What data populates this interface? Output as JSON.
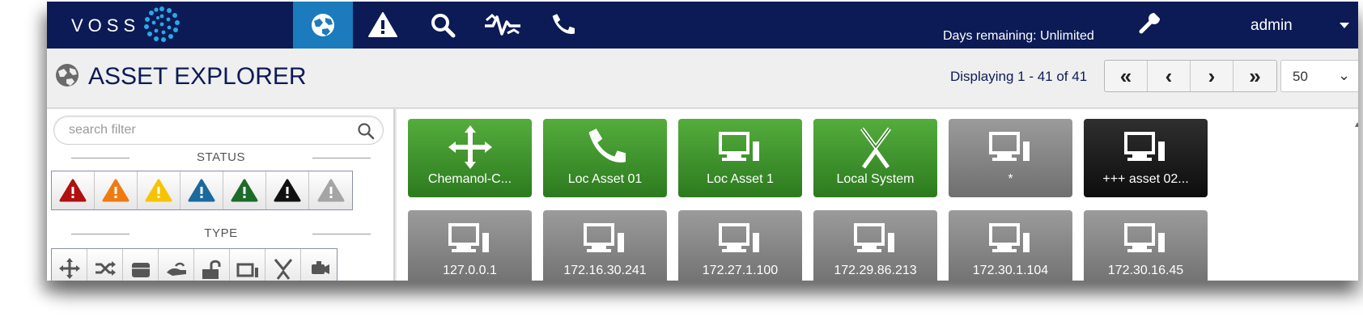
{
  "brand": {
    "logo_text": "VOSS"
  },
  "topnav": {
    "items": [
      {
        "icon": "globe-icon",
        "active": true
      },
      {
        "icon": "alert-icon",
        "active": false
      },
      {
        "icon": "search-icon",
        "active": false
      },
      {
        "icon": "signal-icon",
        "active": false
      },
      {
        "icon": "phone-icon",
        "active": false
      }
    ],
    "days_remaining": "Days remaining: Unlimited",
    "settings_icon": "wrench-icon",
    "user": "admin"
  },
  "header": {
    "title": "ASSET EXPLORER",
    "title_icon": "globe-icon",
    "displaying": "Displaying 1 - 41 of 41",
    "pager": {
      "first": "«",
      "prev": "‹",
      "next": "›",
      "last": "»"
    },
    "per_page": "50"
  },
  "sidebar": {
    "search_placeholder": "search filter",
    "status_label": "STATUS",
    "type_label": "TYPE",
    "status_colors": [
      "#b01010",
      "#f07a12",
      "#f5c400",
      "#1a6a9e",
      "#1d6b2a",
      "#111111",
      "#a5a5a5"
    ],
    "type_icons": [
      "move-icon",
      "shuffle-icon",
      "storage-icon",
      "hand-icon",
      "lock-icon",
      "computer-icon",
      "x-icon",
      "camera-icon"
    ]
  },
  "assets": [
    {
      "label": "Chemanol-C...",
      "color": "green",
      "icon": "move-icon"
    },
    {
      "label": "Loc Asset 01",
      "color": "green",
      "icon": "phone-icon"
    },
    {
      "label": "Loc Asset 1",
      "color": "green",
      "icon": "computer-icon"
    },
    {
      "label": "Local System",
      "color": "green",
      "icon": "x-icon"
    },
    {
      "label": "*",
      "color": "grey",
      "icon": "computer-icon"
    },
    {
      "label": "+++ asset 02...",
      "color": "black",
      "icon": "computer-icon"
    },
    {
      "label": "127.0.0.1",
      "color": "grey",
      "icon": "computer-icon"
    },
    {
      "label": "172.16.30.241",
      "color": "grey",
      "icon": "computer-icon"
    },
    {
      "label": "172.27.1.100",
      "color": "grey",
      "icon": "computer-icon"
    },
    {
      "label": "172.29.86.213",
      "color": "grey",
      "icon": "computer-icon"
    },
    {
      "label": "172.30.1.104",
      "color": "grey",
      "icon": "computer-icon"
    },
    {
      "label": "172.30.16.45",
      "color": "grey",
      "icon": "computer-icon"
    }
  ]
}
